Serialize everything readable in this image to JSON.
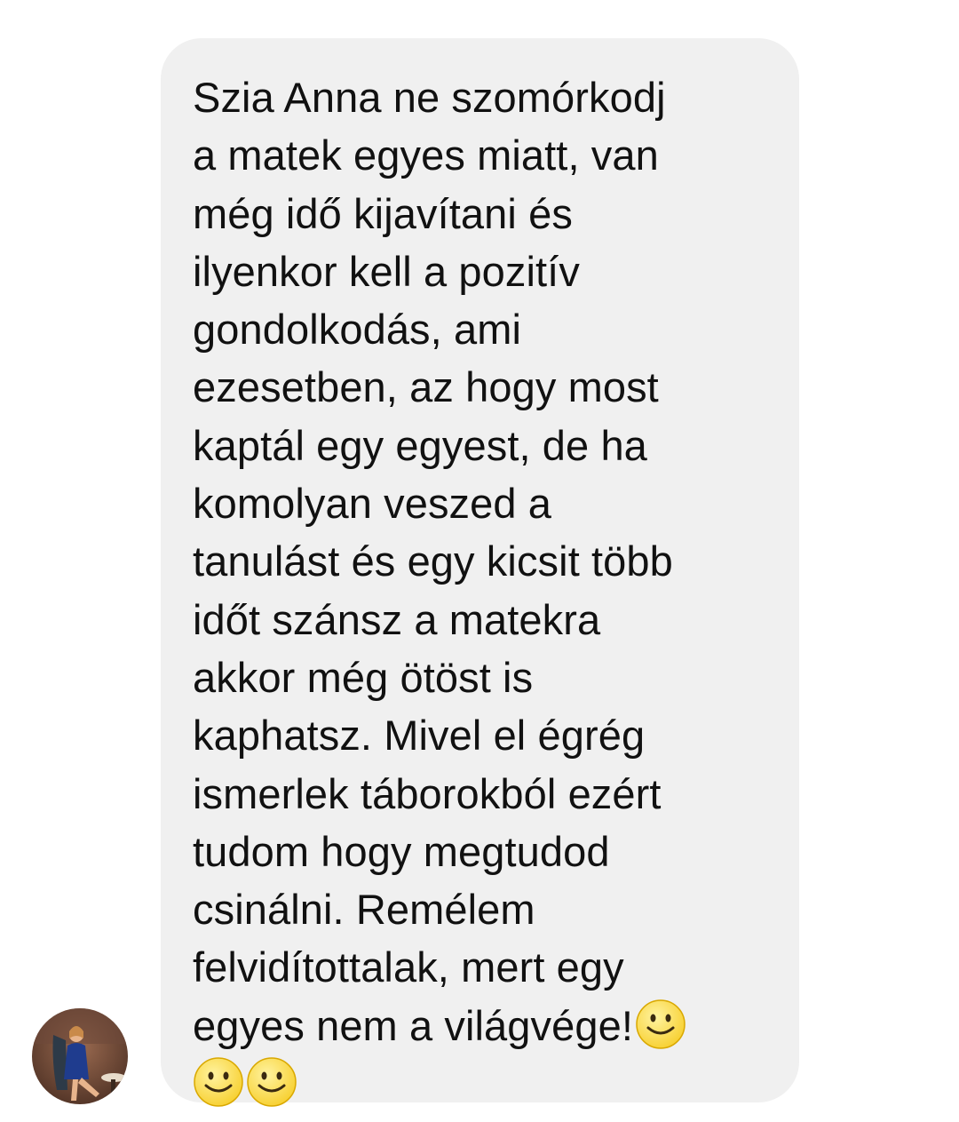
{
  "message": {
    "lines": [
      "Szia Anna ne szomórkodj",
      "a matek egyes miatt, van",
      "még idő kijavítani és",
      "ilyenkor kell a pozitív",
      "gondolkodás, ami",
      "ezesetben, az hogy most",
      "kaptál egy egyest, de ha",
      "komolyan veszed a",
      "tanulást és egy kicsit több",
      "időt szánsz a matekra",
      "akkor még ötöst is",
      "kaphatsz. Mivel el égrég",
      "ismerlek táborokból ezért",
      "tudom hogy megtudod",
      "csinálni. Remélem",
      "felvidítottalak, mert egy",
      "egyes nem a világvége!"
    ],
    "emojis": [
      "slightly-smiling-face-icon",
      "slightly-smiling-face-icon",
      "slightly-smiling-face-icon"
    ],
    "bubble_color": "#f0f0f0",
    "text_color": "#111111"
  },
  "sender": {
    "avatar": "avatar"
  }
}
